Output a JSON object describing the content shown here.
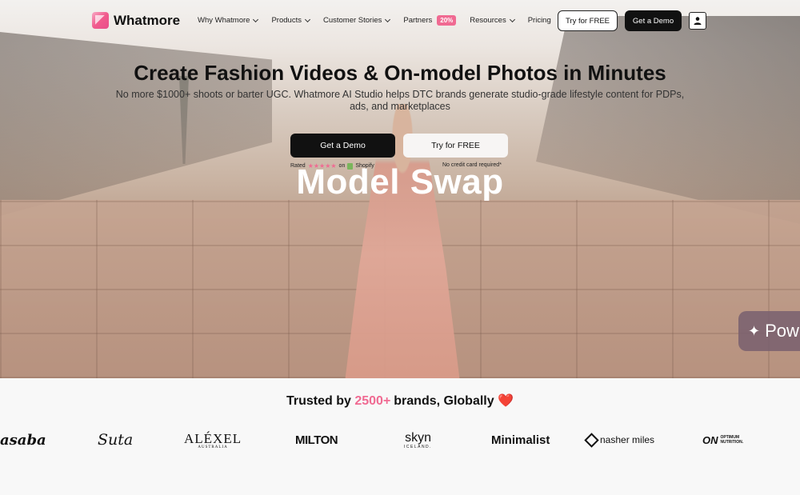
{
  "nav": {
    "brand": "Whatmore",
    "items": [
      {
        "label": "Why Whatmore",
        "has_chevron": true
      },
      {
        "label": "Products",
        "has_chevron": true
      },
      {
        "label": "Customer Stories",
        "has_chevron": true
      },
      {
        "label": "Partners",
        "badge": "20%"
      },
      {
        "label": "Resources",
        "has_chevron": true
      },
      {
        "label": "Pricing"
      }
    ],
    "try_label": "Try for FREE",
    "demo_label": "Get a Demo",
    "user_icon": "user-icon"
  },
  "hero": {
    "headline": "Create Fashion Videos & On-model Photos in Minutes",
    "subline": "No more $1000+ shoots or barter UGC. Whatmore AI Studio helps DTC brands generate studio-grade lifestyle content for PDPs, ads, and marketplaces",
    "demo_label": "Get a Demo",
    "try_label": "Try for FREE",
    "rated_prefix": "Rated",
    "stars": "★★★★★",
    "rated_on": "on",
    "rated_platform": "Shopify",
    "no_card": "No credit card required*",
    "overlay_title": "Model Swap",
    "chip_text": "Pow"
  },
  "trusted": {
    "prefix": "Trusted by",
    "count": "2500+",
    "suffix": "brands, Globally",
    "heart": "❤️"
  },
  "brands": {
    "asaba": "asaba",
    "suta": "Suta",
    "alexel": "ALÉXEL",
    "alexel_sub": "AUSTRALIA",
    "milton": "MILTON",
    "skyn": "skyn",
    "skyn_sub": "ICELAND.",
    "minimalist": "Minimalist",
    "nasher": "nasher miles",
    "on": "ON",
    "on_sub1": "OPTIMUM",
    "on_sub2": "NUTRITION."
  },
  "colors": {
    "accent": "#f06a92",
    "dark": "#111111"
  }
}
